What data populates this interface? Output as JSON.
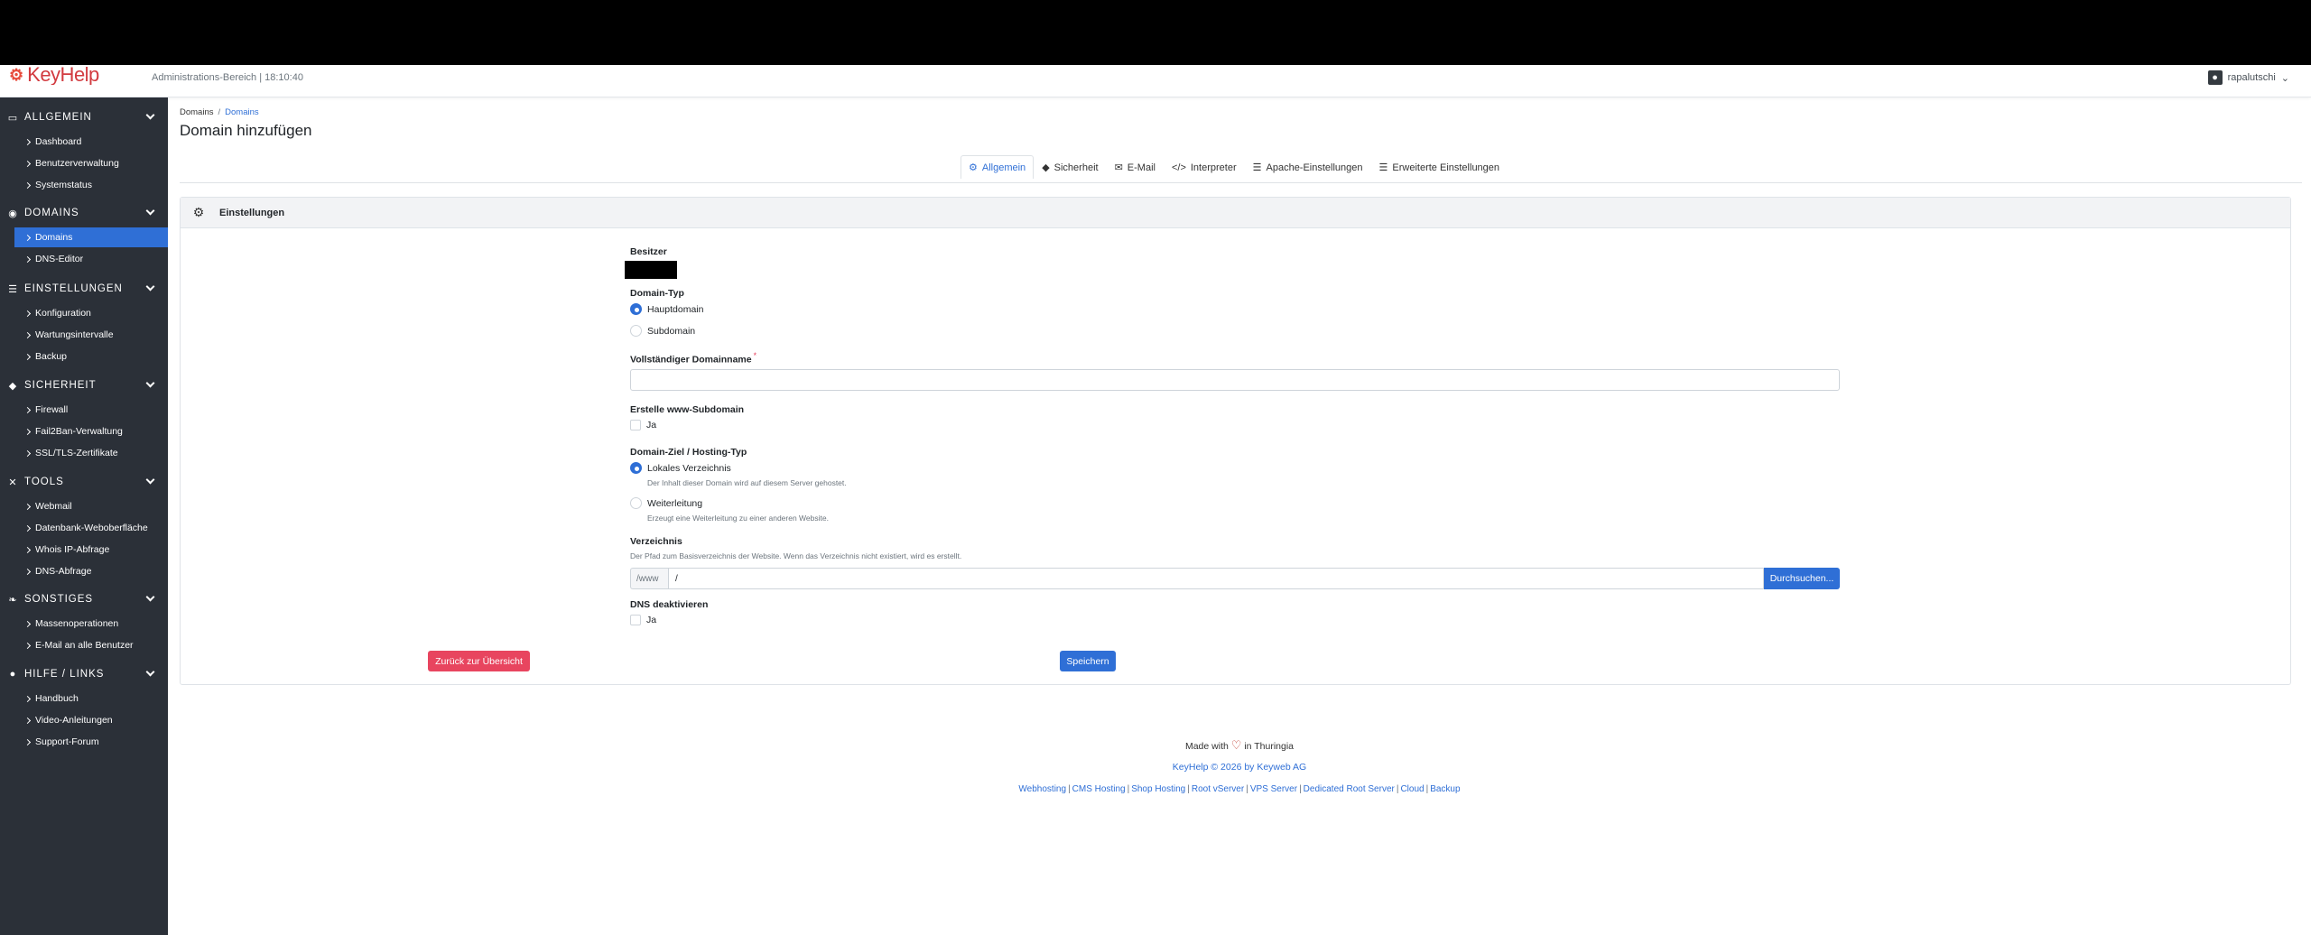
{
  "header": {
    "logo_text": "KeyHelp",
    "subtitle": "Administrations-Bereich | 18:10:40",
    "user": "rapalutschi"
  },
  "sidebar": {
    "sections": [
      {
        "title": "Allgemein",
        "icon": "monitor-icon",
        "items": [
          "Dashboard",
          "Benutzerverwaltung",
          "Systemstatus"
        ]
      },
      {
        "title": "Domains",
        "icon": "globe-icon",
        "items": [
          "Domains",
          "DNS-Editor"
        ]
      },
      {
        "title": "Einstellungen",
        "icon": "sliders-icon",
        "items": [
          "Konfiguration",
          "Wartungsintervalle",
          "Backup"
        ]
      },
      {
        "title": "Sicherheit",
        "icon": "shield-icon",
        "items": [
          "Firewall",
          "Fail2Ban-Verwaltung",
          "SSL/TLS-Zertifikate"
        ]
      },
      {
        "title": "Tools",
        "icon": "tools-icon",
        "items": [
          "Webmail",
          "Datenbank-Weboberfläche",
          "Whois IP-Abfrage",
          "DNS-Abfrage"
        ]
      },
      {
        "title": "Sonstiges",
        "icon": "leaf-icon",
        "items": [
          "Massenoperationen",
          "E-Mail an alle Benutzer"
        ]
      },
      {
        "title": "Hilfe / Links",
        "icon": "help-icon",
        "items": [
          "Handbuch",
          "Video-Anleitungen",
          "Support-Forum"
        ]
      }
    ],
    "active_item": "Domains"
  },
  "breadcrumb": {
    "root": "Domains",
    "current": "Domains"
  },
  "page_title": "Domain hinzufügen",
  "tabs": [
    {
      "label": "Allgemein",
      "icon": "gear-icon",
      "active": true
    },
    {
      "label": "Sicherheit",
      "icon": "shield-icon",
      "active": false
    },
    {
      "label": "E-Mail",
      "icon": "envelope-icon",
      "active": false
    },
    {
      "label": "Interpreter",
      "icon": "code-icon",
      "active": false
    },
    {
      "label": "Apache-Einstellungen",
      "icon": "server-icon",
      "active": false
    },
    {
      "label": "Erweiterte Einstellungen",
      "icon": "sliders-icon",
      "active": false
    }
  ],
  "card": {
    "title": "Einstellungen",
    "owner_label": "Besitzer",
    "domain_type_label": "Domain-Typ",
    "domain_type_options": [
      "Hauptdomain",
      "Subdomain"
    ],
    "domain_type_selected": "Hauptdomain",
    "fqdn_label": "Vollständiger Domainname",
    "fqdn_required": "*",
    "fqdn_value": "",
    "www_label": "Erstelle www-Subdomain",
    "www_option": "Ja",
    "target_label": "Domain-Ziel / Hosting-Typ",
    "target_local": "Lokales Verzeichnis",
    "target_local_hint": "Der Inhalt dieser Domain wird auf diesem Server gehostet.",
    "target_redirect": "Weiterleitung",
    "target_redirect_hint": "Erzeugt eine Weiterleitung zu einer anderen Website.",
    "dir_label": "Verzeichnis",
    "dir_hint": "Der Pfad zum Basisverzeichnis der Website. Wenn das Verzeichnis nicht existiert, wird es erstellt.",
    "dir_prefix": "/www",
    "dir_value": "/",
    "browse_button": "Durchsuchen...",
    "dns_label": "DNS deaktivieren",
    "dns_option": "Ja",
    "back_button": "Zurück zur Übersicht",
    "save_button": "Speichern"
  },
  "footer": {
    "made_with": "Made with",
    "made_in": "in Thuringia",
    "copyright": "KeyHelp © 2026 by Keyweb AG",
    "links": [
      "Webhosting",
      "CMS Hosting",
      "Shop Hosting",
      "Root vServer",
      "VPS Server",
      "Dedicated Root Server",
      "Cloud",
      "Backup"
    ]
  },
  "colors": {
    "accent": "#2f6fd6",
    "danger": "#e8455f",
    "sidebar": "#2b3038"
  }
}
